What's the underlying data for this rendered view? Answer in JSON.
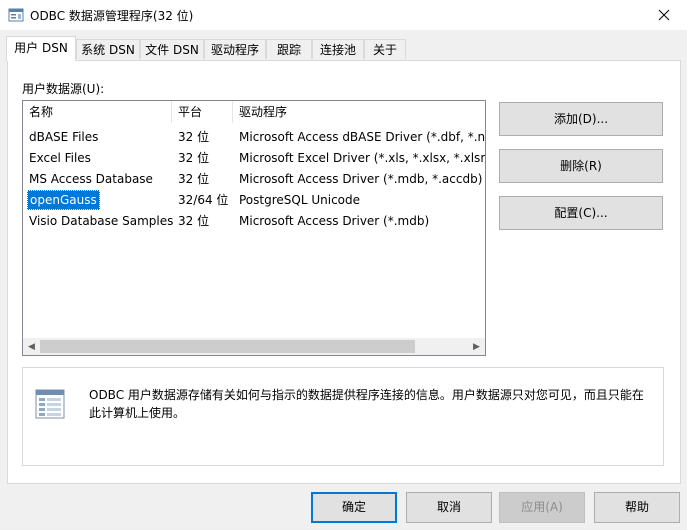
{
  "window": {
    "title": "ODBC 数据源管理程序(32 位)"
  },
  "tabs": [
    {
      "label": "用户 DSN",
      "active": true
    },
    {
      "label": "系统 DSN"
    },
    {
      "label": "文件 DSN"
    },
    {
      "label": "驱动程序"
    },
    {
      "label": "跟踪"
    },
    {
      "label": "连接池"
    },
    {
      "label": "关于"
    }
  ],
  "panel": {
    "section_label": "用户数据源(U):"
  },
  "list": {
    "columns": [
      "名称",
      "平台",
      "驱动程序"
    ],
    "rows": [
      {
        "name": "dBASE Files",
        "platform": "32 位",
        "driver": "Microsoft Access dBASE Driver (*.dbf, *.ndx"
      },
      {
        "name": "Excel Files",
        "platform": "32 位",
        "driver": "Microsoft Excel Driver (*.xls, *.xlsx, *.xlsm, *"
      },
      {
        "name": "MS Access Database",
        "platform": "32 位",
        "driver": "Microsoft Access Driver (*.mdb, *.accdb)"
      },
      {
        "name": "openGauss",
        "platform": "32/64 位",
        "driver": "PostgreSQL Unicode",
        "selected": true
      },
      {
        "name": "Visio Database Samples",
        "platform": "32 位",
        "driver": "Microsoft Access Driver (*.mdb)"
      }
    ]
  },
  "buttons": {
    "add": "添加(D)...",
    "remove": "删除(R)",
    "configure": "配置(C)..."
  },
  "info": {
    "text": "ODBC 用户数据源存储有关如何与指示的数据提供程序连接的信息。用户数据源只对您可见，而且只能在此计算机上使用。",
    "icon": "data-source-icon"
  },
  "footer": {
    "ok": "确定",
    "cancel": "取消",
    "apply": "应用(A)",
    "help": "帮助"
  },
  "colors": {
    "selection": "#0078d7",
    "default_button_border": "#0078d7"
  }
}
